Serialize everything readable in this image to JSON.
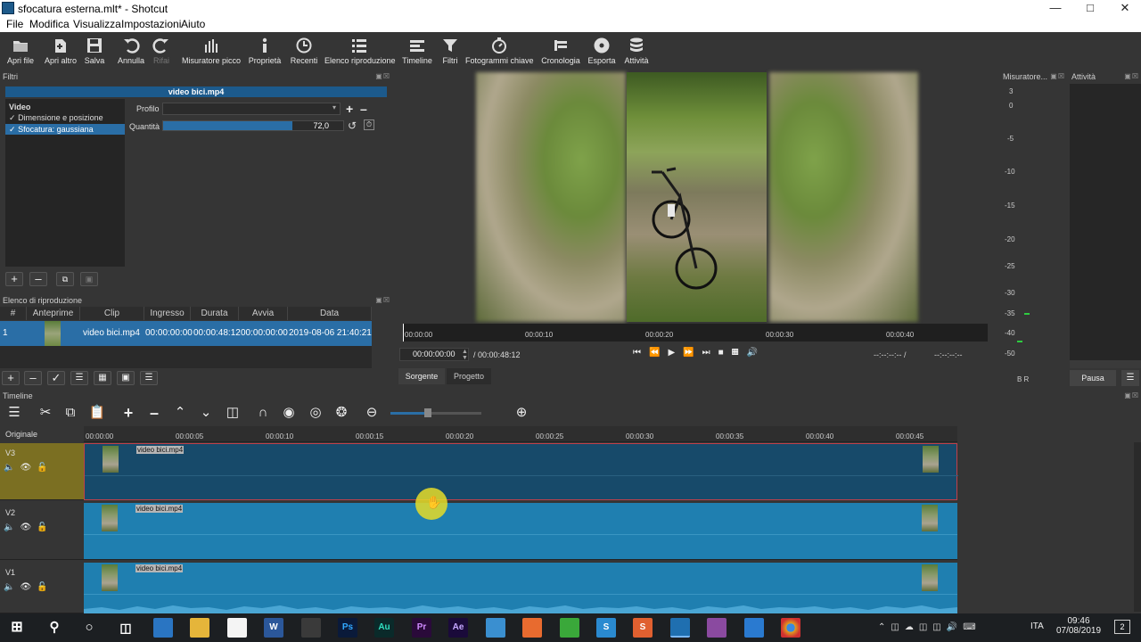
{
  "window": {
    "title": "sfocatura esterna.mlt* - Shotcut"
  },
  "menubar": [
    "File",
    "Modifica",
    "Visualizza",
    "Impostazioni",
    "Aiuto"
  ],
  "toolbar": [
    {
      "label": "Apri file",
      "icon": "folder-open-icon"
    },
    {
      "label": "Apri altro",
      "icon": "open-other-icon"
    },
    {
      "label": "Salva",
      "icon": "save-icon"
    },
    {
      "label": "Annulla",
      "icon": "undo-icon"
    },
    {
      "label": "Rifai",
      "icon": "redo-icon"
    },
    {
      "label": "Misuratore picco",
      "icon": "peak-meter-icon"
    },
    {
      "label": "Proprietà",
      "icon": "info-icon"
    },
    {
      "label": "Recenti",
      "icon": "clock-icon"
    },
    {
      "label": "Elenco riproduzione",
      "icon": "list-icon"
    },
    {
      "label": "Timeline",
      "icon": "timeline-icon"
    },
    {
      "label": "Filtri",
      "icon": "filter-icon"
    },
    {
      "label": "Fotogrammi chiave",
      "icon": "stopwatch-icon"
    },
    {
      "label": "Cronologia",
      "icon": "history-icon"
    },
    {
      "label": "Esporta",
      "icon": "export-disc-icon"
    },
    {
      "label": "Attività",
      "icon": "jobs-icon"
    }
  ],
  "filters": {
    "header": "Filtri",
    "clip_title": "video bici.mp4",
    "section": "Video",
    "items": [
      {
        "label": "Dimensione e posizione",
        "checked": true,
        "selected": false
      },
      {
        "label": "Sfocatura: gaussiana",
        "checked": true,
        "selected": true
      }
    ],
    "profile_label": "Profilo",
    "amount_label": "Quantità",
    "amount_value": "72,0",
    "amount_fraction": 0.72
  },
  "playlist": {
    "header": "Elenco di riproduzione",
    "columns": [
      "#",
      "Anteprime",
      "Clip",
      "Ingresso",
      "Durata",
      "Avvia",
      "Data"
    ],
    "rows": [
      {
        "num": "1",
        "clip": "video bici.mp4",
        "in": "00:00:00:00",
        "duration": "00:00:48:12",
        "start": "00:00:00:00",
        "date": "2019-08-06 21:40:21"
      }
    ]
  },
  "player": {
    "ruler": [
      "00:00:00",
      "00:00:10",
      "00:00:20",
      "00:00:30",
      "00:00:40"
    ],
    "timecode": "00:00:00:00",
    "total": "/ 00:00:48:12",
    "in_point": "--:--:--:-- /",
    "out_point": "--:--:--:--",
    "tabs": [
      "Sorgente",
      "Progetto"
    ]
  },
  "meter": {
    "header": "Misuratore...",
    "scale": [
      "3",
      "0",
      "-5",
      "-10",
      "-15",
      "-20",
      "-25",
      "-30",
      "-35",
      "-40",
      "-50"
    ],
    "channels": "B R"
  },
  "activity": {
    "header": "Attività",
    "pause": "Pausa"
  },
  "timeline": {
    "header": "Timeline",
    "first_label": "Originale",
    "ruler": [
      "00:00:00",
      "00:00:05",
      "00:00:10",
      "00:00:15",
      "00:00:20",
      "00:00:25",
      "00:00:30",
      "00:00:35",
      "00:00:40",
      "00:00:45"
    ],
    "tracks": [
      {
        "name": "V3",
        "clip": "video bici.mp4"
      },
      {
        "name": "V2",
        "clip": "video bici.mp4"
      },
      {
        "name": "V1",
        "clip": "video bici.mp4"
      }
    ]
  },
  "taskbar": {
    "lang": "ITA",
    "time": "09:46",
    "date": "07/08/2019",
    "notifications": "2"
  },
  "colors": {
    "accent": "#2a6ea6",
    "clip": "#1f7fb0",
    "clip_selected": "#174a6a",
    "track_selected": "#7b6f22"
  }
}
